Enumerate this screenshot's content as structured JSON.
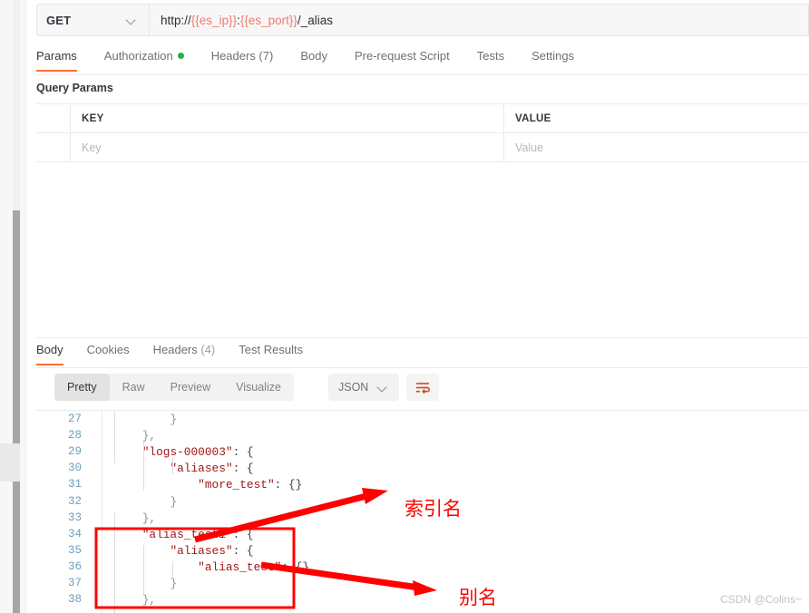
{
  "request": {
    "method": "GET",
    "method_chevron_icon": "chevron-down-icon",
    "url_prefix": "http://",
    "url_var_ip": "{{es_ip}}",
    "url_colon": ":",
    "url_var_port": "{{es_port}}",
    "url_suffix": "/_alias",
    "url_full": "http://{{es_ip}}:{{es_port}}/_alias",
    "tabs": [
      {
        "label": "Params",
        "active": true,
        "dot": false,
        "count": ""
      },
      {
        "label": "Authorization",
        "active": false,
        "dot": true,
        "count": ""
      },
      {
        "label": "Headers (7)",
        "active": false,
        "dot": false,
        "count": ""
      },
      {
        "label": "Body",
        "active": false,
        "dot": false,
        "count": ""
      },
      {
        "label": "Pre-request Script",
        "active": false,
        "dot": false,
        "count": ""
      },
      {
        "label": "Tests",
        "active": false,
        "dot": false,
        "count": ""
      },
      {
        "label": "Settings",
        "active": false,
        "dot": false,
        "count": ""
      }
    ]
  },
  "params": {
    "section_title": "Query Params",
    "columns": [
      "KEY",
      "VALUE"
    ],
    "rows": [
      {
        "key_placeholder": "Key",
        "value_placeholder": "Value"
      }
    ]
  },
  "response": {
    "tabs": [
      {
        "label": "Body",
        "count": "",
        "active": true
      },
      {
        "label": "Cookies",
        "count": "",
        "active": false
      },
      {
        "label": "Headers",
        "count": "(4)",
        "active": false
      },
      {
        "label": "Test Results",
        "count": "",
        "active": false
      }
    ],
    "view_modes": [
      {
        "label": "Pretty",
        "active": true
      },
      {
        "label": "Raw",
        "active": false
      },
      {
        "label": "Preview",
        "active": false
      },
      {
        "label": "Visualize",
        "active": false
      }
    ],
    "format": "JSON",
    "format_chevron_icon": "chevron-down-icon",
    "wrap_button_icon": "word-wrap-icon"
  },
  "code": {
    "lines": [
      {
        "num": "27",
        "indent": 3,
        "text": "}"
      },
      {
        "num": "28",
        "indent": 2,
        "text": "},"
      },
      {
        "num": "29",
        "indent": 2,
        "key": "\"logs-000003\"",
        "text": ": {"
      },
      {
        "num": "30",
        "indent": 3,
        "key": "\"aliases\"",
        "text": ": {"
      },
      {
        "num": "31",
        "indent": 4,
        "key": "\"more_test\"",
        "text": ": {}"
      },
      {
        "num": "32",
        "indent": 3,
        "text": "}"
      },
      {
        "num": "33",
        "indent": 2,
        "text": "},"
      },
      {
        "num": "34",
        "indent": 2,
        "key": "\"alias_test1\"",
        "text": ": {"
      },
      {
        "num": "35",
        "indent": 3,
        "key": "\"aliases\"",
        "text": ": {"
      },
      {
        "num": "36",
        "indent": 4,
        "key": "\"alias_test\"",
        "text": ": {}"
      },
      {
        "num": "37",
        "indent": 3,
        "text": "}"
      },
      {
        "num": "38",
        "indent": 2,
        "text": "},"
      }
    ]
  },
  "annotations": {
    "color": "#ff0000",
    "index_name_label": "索引名",
    "alias_name_label": "别名"
  },
  "watermark": "CSDN @Colins~",
  "colors": {
    "accent": "#ff6c37",
    "auth_dot": "#26b14c",
    "variable": "#f07b72",
    "json_key": "#a31515",
    "line_number": "#6c9fbb",
    "annotation": "#ff0000"
  }
}
